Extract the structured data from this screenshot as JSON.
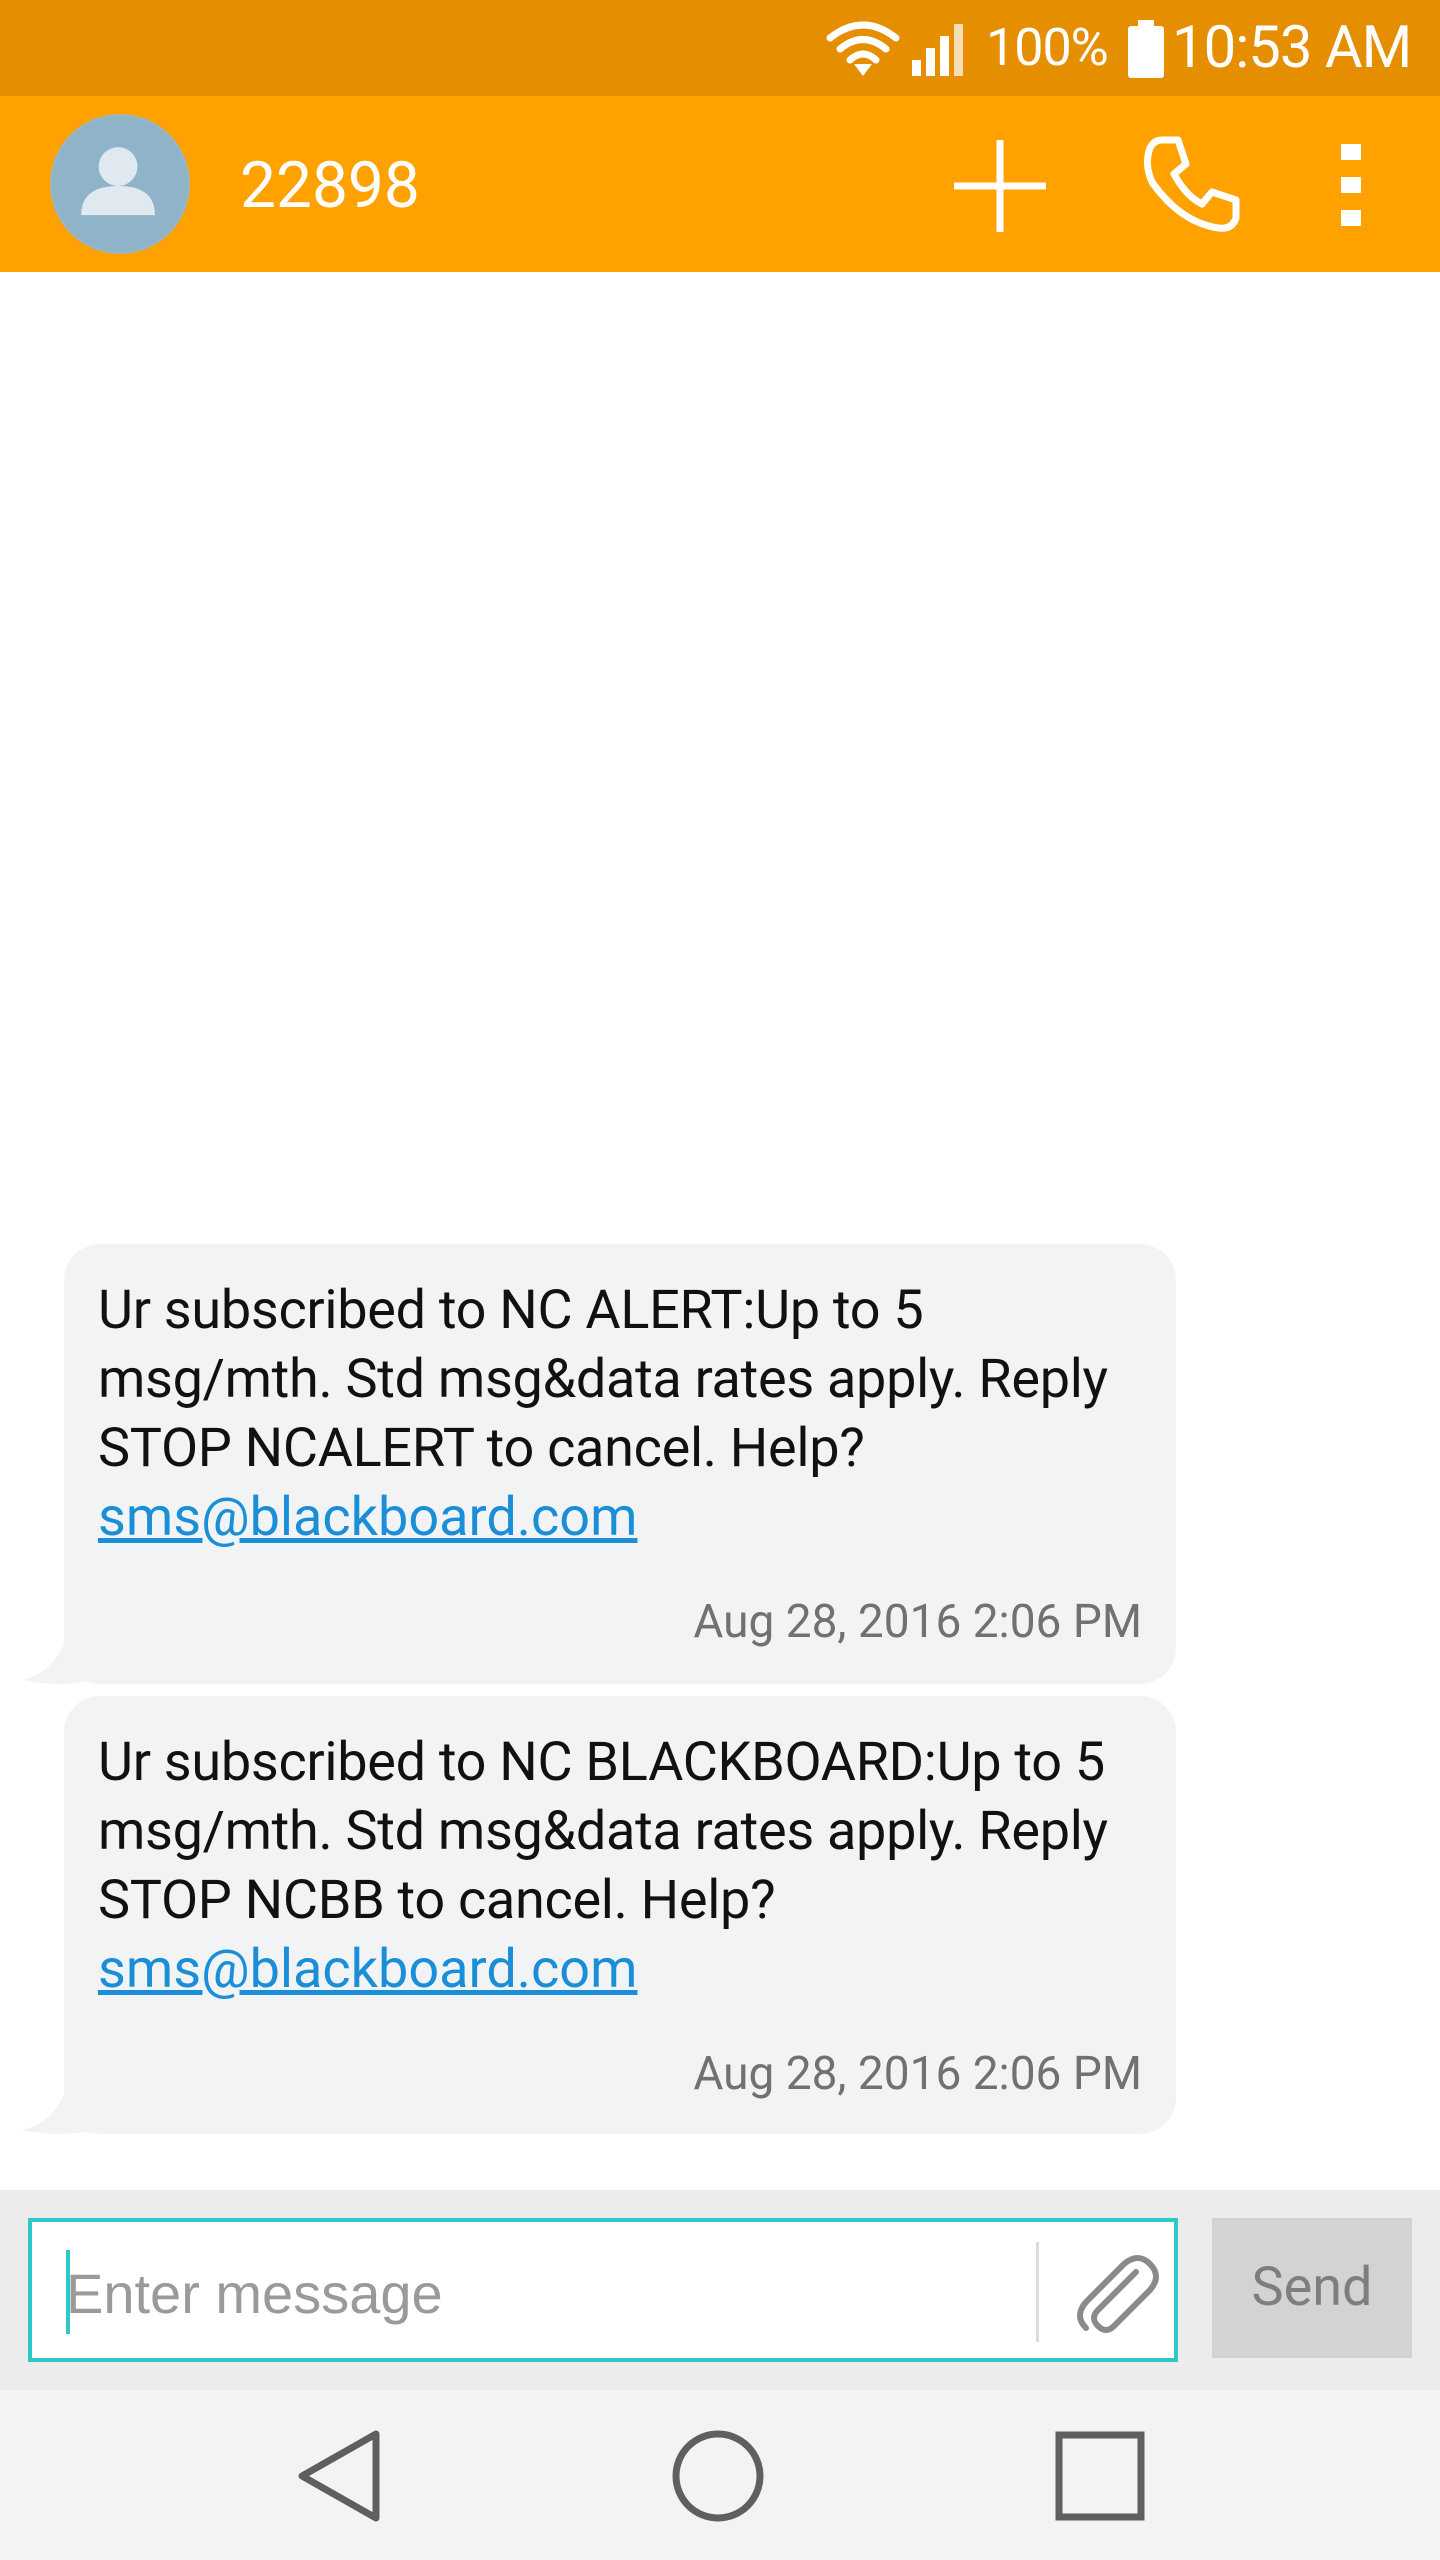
{
  "status_bar": {
    "battery_percent": "100%",
    "time": "10:53 AM",
    "icons": [
      "wifi-icon",
      "signal-icon",
      "battery-icon"
    ]
  },
  "app_bar": {
    "contact": "22898",
    "icons": [
      "avatar-icon",
      "add-icon",
      "call-icon",
      "more-icon"
    ]
  },
  "messages": [
    {
      "text": "Ur subscribed to NC ALERT:Up to 5 msg/mth. Std msg&data rates apply. Reply STOP NCALERT to cancel. Help?",
      "link": "sms@blackboard.com",
      "time": "Aug 28, 2016 2:06 PM"
    },
    {
      "text": "Ur subscribed to NC BLACKBOARD:Up to 5 msg/mth. Std msg&data rates apply. Reply STOP NCBB to cancel. Help?",
      "link": "sms@blackboard.com",
      "time": "Aug 28, 2016 2:06 PM"
    }
  ],
  "compose": {
    "placeholder": "Enter message",
    "value": "",
    "send_label": "Send"
  },
  "nav": {
    "icons": [
      "back-icon",
      "home-icon",
      "recents-icon"
    ]
  },
  "colors": {
    "status_bar": "#e58e00",
    "app_bar": "#ffa200",
    "bubble": "#f1f3f5",
    "link": "#1b8ed8",
    "compose_border": "#2ec8c8"
  }
}
